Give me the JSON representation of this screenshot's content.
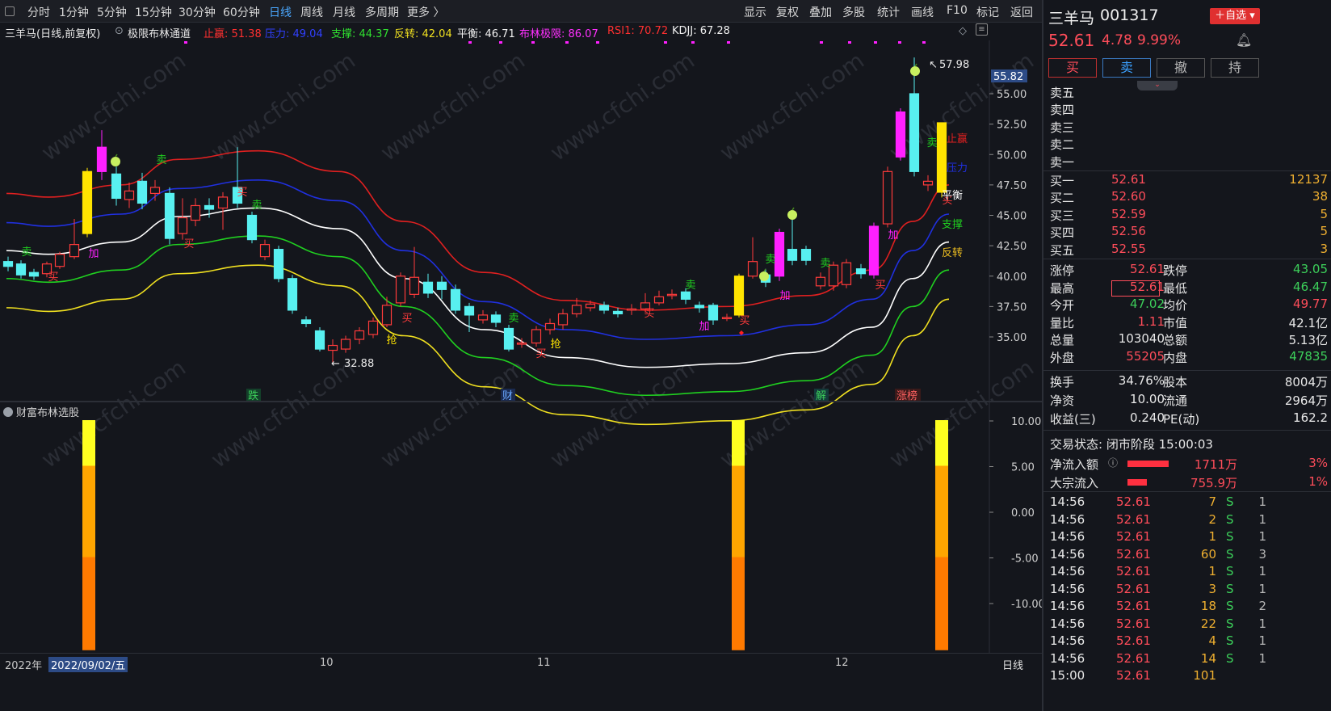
{
  "toolbar": {
    "periods": [
      "分时",
      "1分钟",
      "5分钟",
      "15分钟",
      "30分钟",
      "60分钟",
      "日线",
      "周线",
      "月线",
      "多周期",
      "更多 〉"
    ],
    "active": "日线",
    "tools": [
      "显示",
      "复权",
      "叠加",
      "多股",
      "统计",
      "画线",
      "F10",
      "标记",
      "返回"
    ]
  },
  "info": {
    "stock": "三羊马(日线,前复权)",
    "indicator": "极限布林通道",
    "zhiying": "止赢: 51.38",
    "yali": "压力: 49.04",
    "zhicheng": "支撑: 44.37",
    "fanzhuan": "反转: 42.04",
    "pingheng": "平衡: 46.71",
    "bulin": "布林极限: 86.07",
    "rsi": "RSI1: 70.72",
    "kdjj": "KDJJ: 67.28"
  },
  "price_axis": {
    "current": "55.82",
    "ticks": [
      "55.00",
      "52.50",
      "50.00",
      "47.50",
      "45.00",
      "42.50",
      "40.00",
      "37.50",
      "35.00"
    ]
  },
  "band_labels": {
    "zhiying": "止赢",
    "yali": "压力",
    "pingheng": "平衡",
    "zhicheng": "支撑",
    "fanzhuan": "反转"
  },
  "annotations": {
    "high": "57.98",
    "low": "32.88",
    "signals": {
      "sell": "卖",
      "buy": "买",
      "add": "加",
      "grab": "抢"
    }
  },
  "events": [
    "跌",
    "财",
    "解",
    "涨榜"
  ],
  "sub": {
    "title": "财富布林选股",
    "ticks": [
      "10.00",
      "5.00",
      "0.00",
      "-5.00",
      "-10.00"
    ]
  },
  "xaxis": {
    "year": "2022年",
    "date": "2022/09/02/五",
    "months": [
      "10",
      "11",
      "12"
    ],
    "period": "日线"
  },
  "colors": {
    "up": "#ff3b3b",
    "down": "#58f0f0",
    "zhiying": "#e02020",
    "yali": "#2030e0",
    "pingheng": "#ffffff",
    "zhicheng": "#20d020",
    "fanzhuan": "#f0e020",
    "magenta": "#ff20ff",
    "yellow": "#ffe400"
  },
  "watermark": "www.cfchi.com",
  "quote": {
    "name": "三羊马",
    "code": "001317",
    "zixuan": "＋自选",
    "price": "52.61",
    "change": "4.78",
    "pct": "9.99%",
    "buttons": [
      "买",
      "卖",
      "撤",
      "持"
    ],
    "asks": [
      {
        "label": "卖五",
        "price": "",
        "vol": ""
      },
      {
        "label": "卖四",
        "price": "",
        "vol": ""
      },
      {
        "label": "卖三",
        "price": "",
        "vol": ""
      },
      {
        "label": "卖二",
        "price": "",
        "vol": ""
      },
      {
        "label": "卖一",
        "price": "",
        "vol": ""
      }
    ],
    "bids": [
      {
        "label": "买一",
        "price": "52.61",
        "vol": "12137"
      },
      {
        "label": "买二",
        "price": "52.60",
        "vol": "38"
      },
      {
        "label": "买三",
        "price": "52.59",
        "vol": "5"
      },
      {
        "label": "买四",
        "price": "52.56",
        "vol": "5"
      },
      {
        "label": "买五",
        "price": "52.55",
        "vol": "3"
      }
    ],
    "stats": [
      [
        "涨停",
        "52.61",
        "跌停",
        "43.05"
      ],
      [
        "最高",
        "52.61",
        "最低",
        "46.47"
      ],
      [
        "今开",
        "47.02",
        "均价",
        "49.77"
      ],
      [
        "量比",
        "1.11",
        "市值",
        "42.1亿"
      ],
      [
        "总量",
        "103040",
        "总额",
        "5.13亿"
      ],
      [
        "外盘",
        "55205",
        "内盘",
        "47835"
      ]
    ],
    "stats2": [
      [
        "换手",
        "34.76%",
        "股本",
        "8004万"
      ],
      [
        "净资",
        "10.00",
        "流通",
        "2964万"
      ],
      [
        "收益(三)",
        "0.240",
        "PE(动)",
        "162.2"
      ]
    ],
    "status": "交易状态: 闭市阶段 15:00:03",
    "flows": [
      {
        "label": "净流入额",
        "value": "1711万",
        "pct": "3%",
        "fill": 0.85
      },
      {
        "label": "大宗流入",
        "value": "755.9万",
        "pct": "1%",
        "fill": 0.4
      }
    ],
    "ticks": [
      [
        "14:56",
        "52.61",
        "7",
        "S",
        "1"
      ],
      [
        "14:56",
        "52.61",
        "2",
        "S",
        "1"
      ],
      [
        "14:56",
        "52.61",
        "1",
        "S",
        "1"
      ],
      [
        "14:56",
        "52.61",
        "60",
        "S",
        "3"
      ],
      [
        "14:56",
        "52.61",
        "1",
        "S",
        "1"
      ],
      [
        "14:56",
        "52.61",
        "3",
        "S",
        "1"
      ],
      [
        "14:56",
        "52.61",
        "18",
        "S",
        "2"
      ],
      [
        "14:56",
        "52.61",
        "22",
        "S",
        "1"
      ],
      [
        "14:56",
        "52.61",
        "4",
        "S",
        "1"
      ],
      [
        "14:56",
        "52.61",
        "14",
        "S",
        "1"
      ],
      [
        "15:00",
        "52.61",
        "101",
        "",
        ""
      ]
    ]
  }
}
